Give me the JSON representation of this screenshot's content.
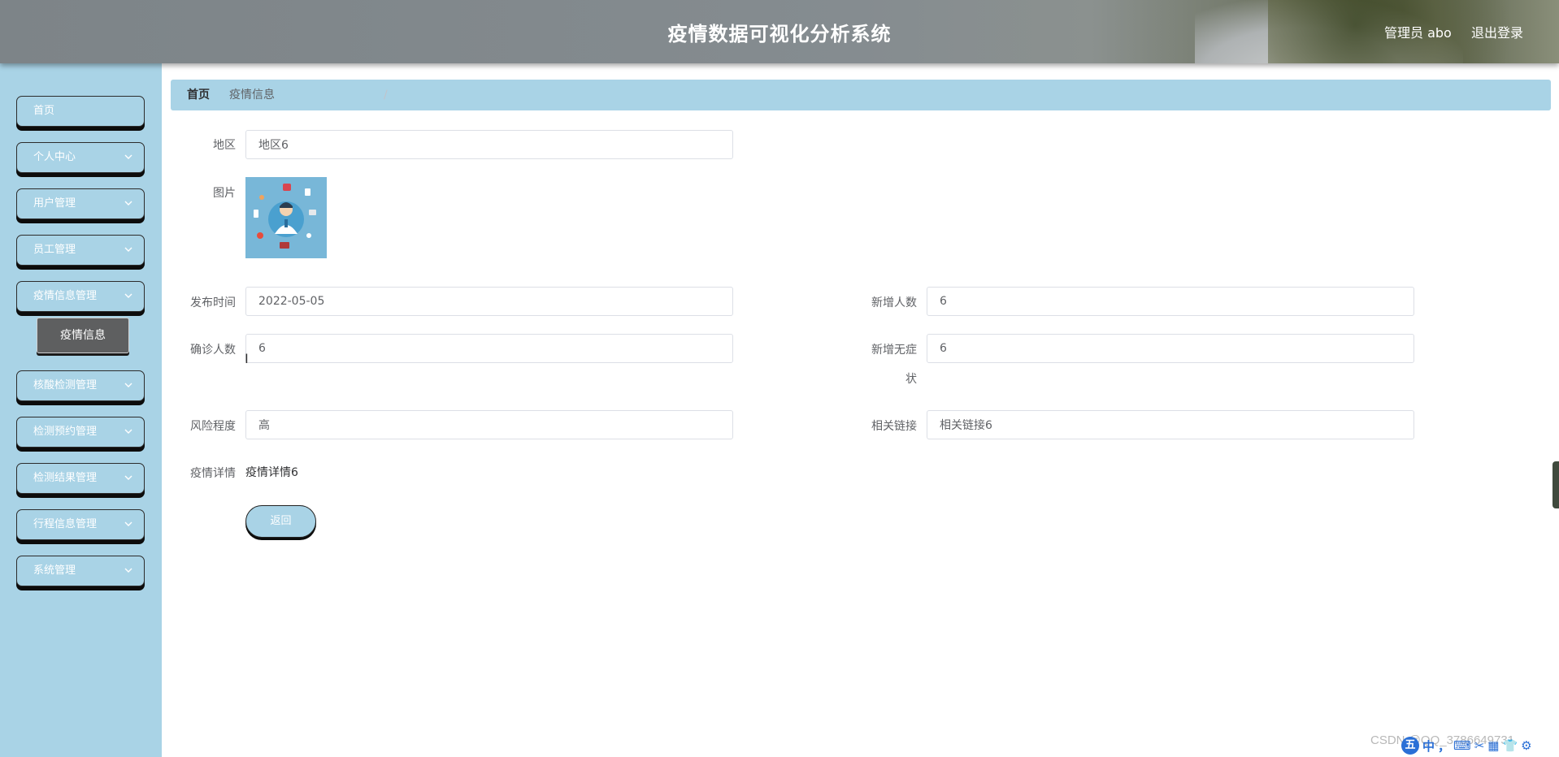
{
  "header": {
    "title": "疫情数据可视化分析系统",
    "user": "管理员 abo",
    "logout": "退出登录"
  },
  "sidebar": {
    "items": [
      {
        "label": "首页"
      },
      {
        "label": "个人中心"
      },
      {
        "label": "用户管理"
      },
      {
        "label": "员工管理"
      },
      {
        "label": "疫情信息管理"
      },
      {
        "label": "核酸检测管理"
      },
      {
        "label": "检测预约管理"
      },
      {
        "label": "检测结果管理"
      },
      {
        "label": "行程信息管理"
      },
      {
        "label": "系统管理"
      }
    ],
    "active_submenu": "疫情信息"
  },
  "breadcrumb": {
    "home": "首页",
    "separator": "/",
    "current": "疫情信息"
  },
  "form": {
    "region_label": "地区",
    "region_value": "地区6",
    "image_label": "图片",
    "publish_time_label": "发布时间",
    "publish_time_value": "2022-05-05",
    "new_cases_label": "新增人数",
    "new_cases_value": "6",
    "confirmed_label": "确诊人数",
    "confirmed_value": "6",
    "new_asymptomatic_label_line1": "新增无症",
    "new_asymptomatic_label_line2": "状",
    "new_asymptomatic_value": "6",
    "risk_label": "风险程度",
    "risk_value": "高",
    "link_label": "相关链接",
    "link_value": "相关链接6",
    "detail_label": "疫情详情",
    "detail_value": "疫情详情6",
    "back_label": "返回"
  },
  "overlay": {
    "watermark": "CSDN @QQ_3786649731",
    "ime_logo": "五",
    "ime_chars": [
      "中",
      "，",
      "⌨",
      "✂",
      "▦",
      "👕",
      "⚙"
    ]
  },
  "colors": {
    "sidebar_bg": "#a9d3e6",
    "submenu_active": "#5e5f60",
    "header_text": "#ffffff"
  }
}
